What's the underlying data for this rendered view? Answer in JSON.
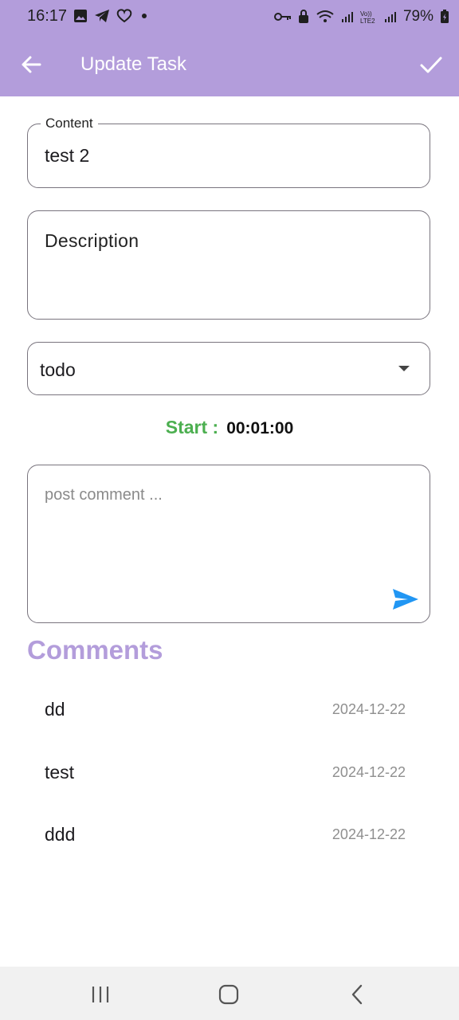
{
  "status_bar": {
    "time": "16:17",
    "battery": "79%",
    "left_icons": [
      "gallery-icon",
      "telegram-icon",
      "heart-icon",
      "dot-icon"
    ],
    "right_icons": [
      "key-icon",
      "lock-icon",
      "wifi-icon",
      "signal-icon",
      "lte-icon",
      "signal-icon",
      "battery-icon"
    ]
  },
  "app_bar": {
    "title": "Update Task",
    "back_icon": "arrow-left-icon",
    "confirm_icon": "check-icon",
    "color": "#b39ddb"
  },
  "form": {
    "content_label": "Content",
    "content_value": "test 2",
    "description_placeholder": "Description",
    "status_value": "todo",
    "timer_label": "Start :",
    "timer_value": "00:01:00",
    "comment_placeholder": "post comment ...",
    "send_icon": "send-icon"
  },
  "comments": {
    "heading": "Comments",
    "items": [
      {
        "text": "dd",
        "date": "2024-12-22"
      },
      {
        "text": "test",
        "date": "2024-12-22"
      },
      {
        "text": "ddd",
        "date": "2024-12-22"
      }
    ]
  },
  "colors": {
    "accent": "#b39ddb",
    "timer_green": "#4caf50",
    "send_blue": "#2196f3"
  }
}
